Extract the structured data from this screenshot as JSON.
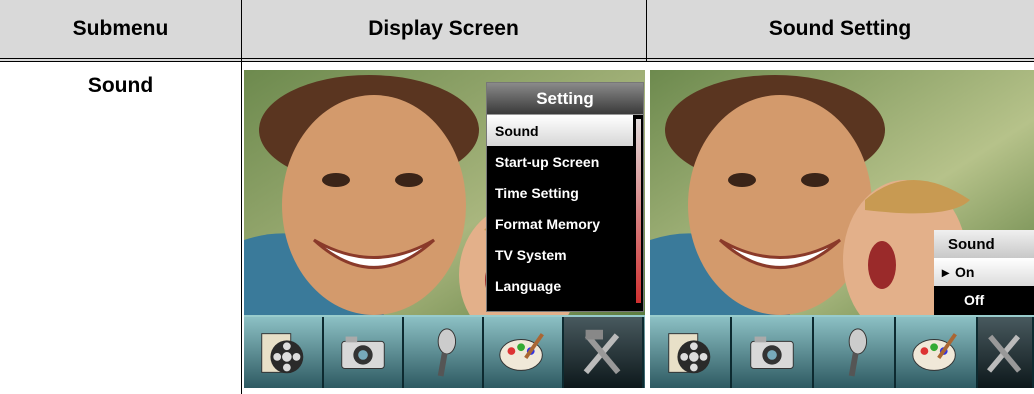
{
  "table": {
    "headers": [
      "Submenu",
      "Display Screen",
      "Sound Setting"
    ],
    "row": {
      "submenu": "Sound"
    }
  },
  "display_screen": {
    "menu_title": "Setting",
    "menu_items": [
      "Sound",
      "Start-up Screen",
      "Time Setting",
      "Format Memory",
      "TV System",
      "Language"
    ],
    "selected": "Sound"
  },
  "sound_screen": {
    "title": "Sound",
    "options": [
      "On",
      "Off"
    ],
    "selected": "On",
    "selection_marker": "▸"
  },
  "icon_bar": {
    "icons": [
      "film-reel-icon",
      "camera-icon",
      "microphone-icon",
      "palette-icon",
      "tools-icon"
    ],
    "active": "tools-icon"
  }
}
